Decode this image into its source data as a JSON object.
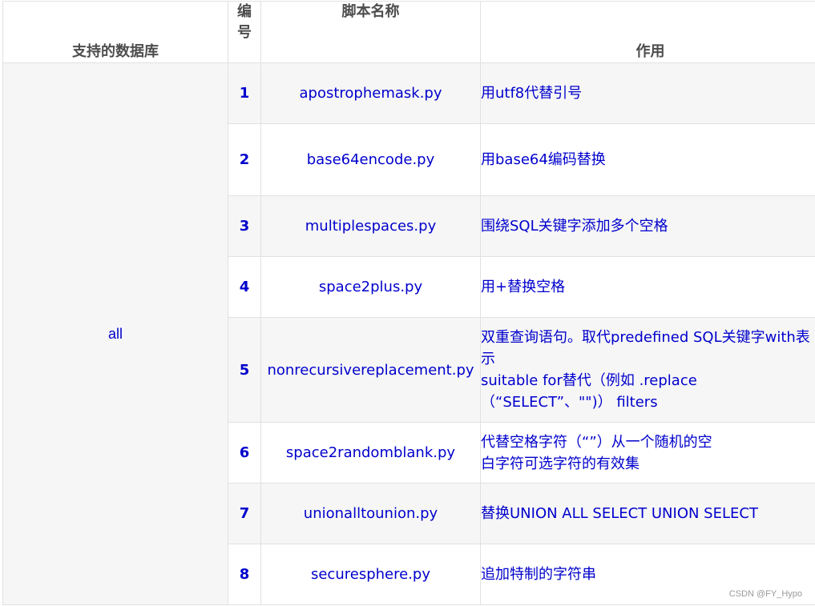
{
  "table": {
    "headers": {
      "database": "支持的数据库",
      "number": "编号",
      "script": "脚本名称",
      "usage": "作用"
    },
    "database_value": "all",
    "rows": [
      {
        "num": "1",
        "script": "apostrophemask.py",
        "usage": [
          "用utf8代替引号"
        ]
      },
      {
        "num": "2",
        "script": "base64encode.py",
        "usage": [
          "用base64编码替换"
        ]
      },
      {
        "num": "3",
        "script": "multiplespaces.py",
        "usage": [
          "围绕SQL关键字添加多个空格"
        ]
      },
      {
        "num": "4",
        "script": "space2plus.py",
        "usage": [
          "用+替换空格"
        ]
      },
      {
        "num": "5",
        "script": "nonrecursivereplacement.py",
        "usage": [
          "双重查询语句。取代predefined SQL关键字with表",
          "示",
          "suitable for替代（例如  .replace",
          "（“SELECT”、\"\")） filters"
        ]
      },
      {
        "num": "6",
        "script": "space2randomblank.py",
        "usage": [
          "代替空格字符（“”）从一个随机的空",
          "白字符可选字符的有效集"
        ]
      },
      {
        "num": "7",
        "script": "unionalltounion.py",
        "usage": [
          "替换UNION ALL SELECT UNION SELECT"
        ]
      },
      {
        "num": "8",
        "script": "securesphere.py",
        "usage": [
          "追加特制的字符串"
        ]
      }
    ]
  },
  "watermark": "CSDN @FY_Hypo"
}
